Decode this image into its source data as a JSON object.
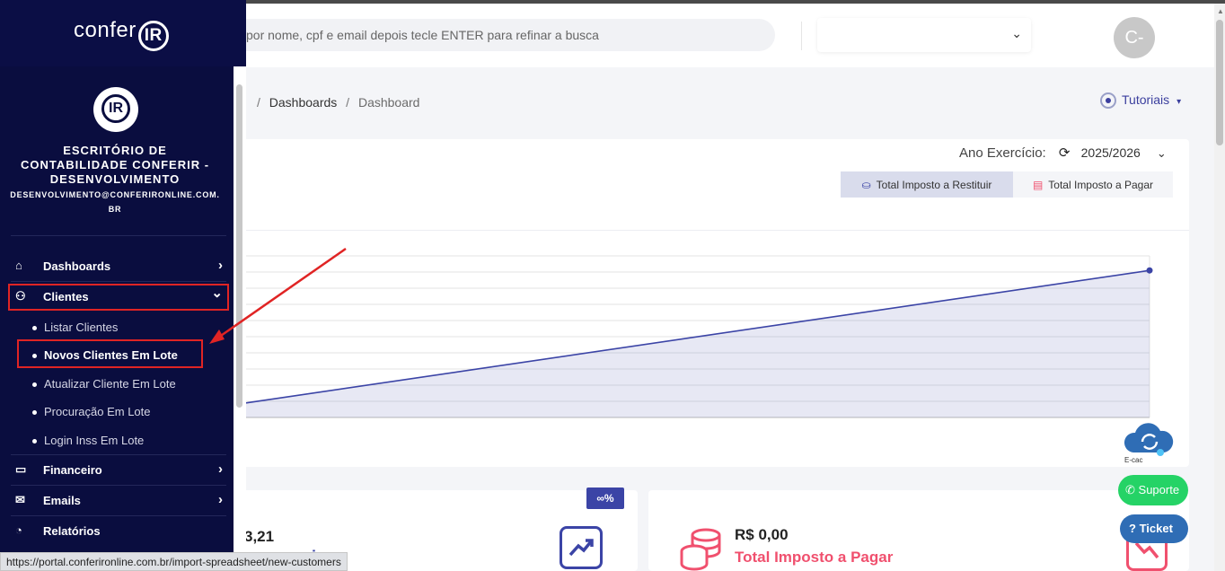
{
  "header": {
    "search_placeholder": "por nome, cpf e email depois tecle ENTER para refinar a busca",
    "select_chevron": "⌄",
    "avatar_initials": "C-"
  },
  "breadcrumb": {
    "items": [
      "Dashboards",
      "Dashboard"
    ],
    "sep": "/"
  },
  "tutoriais": {
    "label": "Tutoriais",
    "caret": "▾"
  },
  "sidebar": {
    "logo_text": "confer",
    "logo_ir": "IR",
    "brand_ir": "IR",
    "company": "ESCRITÓRIO DE CONTABILIDADE CONFERIR - DESENVOLVIMENTO",
    "email": "DESENVOLVIMENTO@CONFERIRONLINE.COM.BR",
    "nav": [
      {
        "label": "Dashboards",
        "icon": "home-icon",
        "chevron": "›"
      },
      {
        "label": "Clientes",
        "icon": "users-icon",
        "chevron": "⌄"
      },
      {
        "label": "Financeiro",
        "icon": "card-icon",
        "chevron": "›"
      },
      {
        "label": "Emails",
        "icon": "mail-icon",
        "chevron": "›"
      },
      {
        "label": "Relatórios",
        "icon": "pie-icon",
        "chevron": ""
      }
    ],
    "submenu": [
      "Listar Clientes",
      "Novos Clientes Em Lote",
      "Atualizar Cliente Em Lote",
      "Procuração Em Lote",
      "Login Inss Em Lote"
    ]
  },
  "card": {
    "ano_label": "Ano Exercício:",
    "ano_value": "2025/2026",
    "tab_restituir": "Total Imposto a Restituir",
    "tab_pagar": "Total Imposto a Pagar"
  },
  "chart_data": {
    "type": "area",
    "x": [
      0,
      1
    ],
    "series": [
      {
        "values": [
          0.09,
          0.91
        ]
      }
    ],
    "ylim": [
      0,
      1
    ],
    "grid": true,
    "legend": "none",
    "color": "#3b44a6"
  },
  "stats": {
    "badge": "∞%",
    "restituir_value": "3,21",
    "restituir_label": "uir",
    "pagar_value": "R$ 0,00",
    "pagar_label": "Total Imposto a Pagar"
  },
  "widgets": {
    "suporte": "Suporte",
    "ticket": "Ticket",
    "ecac": "E-cac"
  },
  "status_url": "https://portal.conferironline.com.br/import-spreadsheet/new-customers"
}
